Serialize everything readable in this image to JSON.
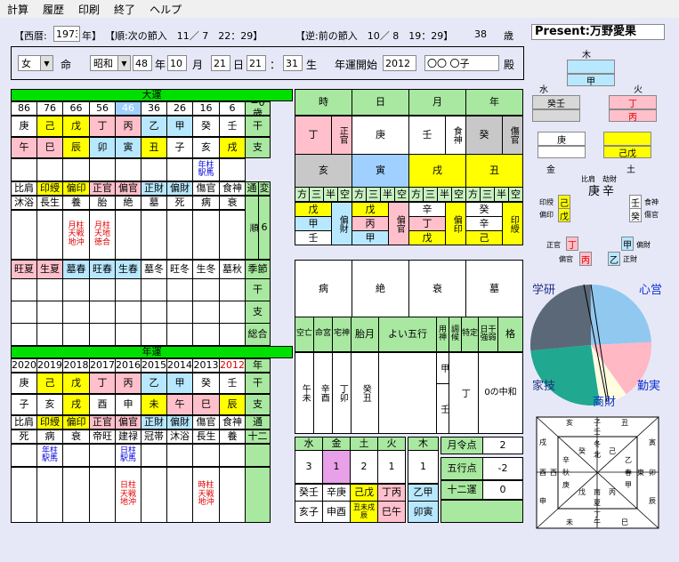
{
  "menu": [
    "計算",
    "履歴",
    "印刷",
    "終了",
    "ヘルプ"
  ],
  "header": {
    "seireki_label": "【西暦:",
    "seireki_value": "1973",
    "nen": "年】",
    "jun": "【順:次の節入　11／ 7　22：29】",
    "gyaku": "【逆:前の節入　10／ 8　19：29】",
    "age": "38",
    "age_unit": "歳",
    "present": "Present:万野愛果"
  },
  "form": {
    "sex": "女",
    "mei": "命",
    "era": "昭和",
    "year": "48",
    "nen": "年",
    "month": "10",
    "tsuki": "月",
    "day": "21",
    "hi": "日",
    "hour": "21",
    "colon": "：",
    "minute": "31",
    "sei": "生",
    "unnen_label": "年運開始",
    "unnen_value": "2012",
    "name": "〇〇 〇子",
    "tono": "殿"
  },
  "daiun": {
    "title": "大運",
    "ages": [
      "86",
      "76",
      "66",
      "56",
      "46",
      "36",
      "26",
      "16",
      "6",
      "−0歳"
    ],
    "stems": [
      "庚",
      "己",
      "戊",
      "丁",
      "丙",
      "乙",
      "甲",
      "癸",
      "壬",
      "干"
    ],
    "branches": [
      "午",
      "巳",
      "辰",
      "卯",
      "寅",
      "丑",
      "子",
      "亥",
      "戌",
      "支"
    ],
    "note_row": [
      "",
      "",
      "",
      "",
      "",
      "",
      "",
      "年柱\n駅馬",
      "",
      ""
    ],
    "stars": [
      "比肩",
      "印綬",
      "偏印",
      "正官",
      "偏官",
      "正財",
      "偏財",
      "傷官",
      "食神",
      "通"
    ],
    "stages": [
      "沐浴",
      "長生",
      "養",
      "胎",
      "絶",
      "墓",
      "死",
      "病",
      "衰",
      "変"
    ],
    "extra": [
      "",
      "",
      "月柱\n天戦\n地沖",
      "月柱\n天地\n徳合",
      "",
      "",
      "",
      "",
      "",
      ""
    ],
    "jun_label": "順",
    "jun_num": "6",
    "seasons": [
      "旺夏",
      "生夏",
      "墓春",
      "旺春",
      "生春",
      "墓冬",
      "旺冬",
      "生冬",
      "墓秋",
      "季節"
    ],
    "side": [
      "干",
      "支",
      "総合"
    ]
  },
  "nenun": {
    "title": "年運",
    "years": [
      "2020",
      "2019",
      "2018",
      "2017",
      "2016",
      "2015",
      "2014",
      "2013",
      "2012",
      "年"
    ],
    "stems": [
      "庚",
      "己",
      "戊",
      "丁",
      "丙",
      "乙",
      "甲",
      "癸",
      "壬",
      "干"
    ],
    "branches": [
      "子",
      "亥",
      "戌",
      "酉",
      "申",
      "未",
      "午",
      "巳",
      "辰",
      "支"
    ],
    "stars": [
      "比肩",
      "印綬",
      "偏印",
      "正官",
      "偏官",
      "正財",
      "偏財",
      "傷官",
      "食神",
      "通"
    ],
    "stages": [
      "死",
      "病",
      "衰",
      "帝旺",
      "建禄",
      "冠帯",
      "沐浴",
      "長生",
      "養",
      "十二"
    ],
    "notes": [
      "",
      "年柱\n駅馬",
      "",
      "",
      "日柱\n駅馬",
      "",
      "",
      "",
      "",
      ""
    ],
    "extra": [
      "",
      "",
      "",
      "",
      "日柱\n天戦\n地沖",
      "",
      "",
      "時柱\n天戦\n地沖",
      "",
      ""
    ]
  },
  "pillars": {
    "headers": [
      "時",
      "日",
      "月",
      "年"
    ],
    "stems": [
      [
        "丁",
        "正官"
      ],
      [
        "庚",
        ""
      ],
      [
        "壬",
        "食神"
      ],
      [
        "癸",
        "傷官"
      ]
    ],
    "branches": [
      "亥",
      "寅",
      "戌",
      "丑"
    ],
    "kuu": [
      "方",
      "三",
      "半",
      "空"
    ],
    "zokan": [
      [
        "戊",
        "甲",
        "壬",
        "偏財"
      ],
      [
        "戊",
        "丙",
        "甲",
        "偏官"
      ],
      [
        "辛",
        "丁",
        "戊",
        "偏印"
      ],
      [
        "癸",
        "辛",
        "己",
        "印綬"
      ]
    ],
    "stages": [
      "病",
      "絶",
      "衰",
      "墓"
    ],
    "bottom_headers": [
      "空亡",
      "命宮",
      "宅神",
      "胎月",
      "よい五行",
      "用神",
      "調候",
      "特定",
      "日干強弱",
      "格"
    ],
    "bottom_vals": [
      "午未",
      "辛酉",
      "丁卯",
      "癸丑",
      "",
      "甲",
      "壬",
      "丁",
      "0の中和",
      ""
    ]
  },
  "gogyo": {
    "headers": [
      "水",
      "金",
      "土",
      "火",
      "木"
    ],
    "counts": [
      "3",
      "1",
      "2",
      "1",
      "1"
    ],
    "pairs": [
      "癸壬",
      "辛庚",
      "己戊",
      "丁丙",
      "乙甲"
    ],
    "pairs2": [
      "亥子",
      "申酉",
      "丑未戌辰",
      "巳午",
      "卯寅"
    ],
    "getsurei_label": "月令点",
    "getsurei": "2",
    "gogyoten_label": "五行点",
    "gogyoten": "-2",
    "juuni_label": "十二運",
    "juuni": "0"
  },
  "chart": {
    "north": "木",
    "west": "水",
    "east": "火",
    "s_left": "金",
    "s_right": "土",
    "mizu1": "癸壬",
    "ki": "甲",
    "hi1": "丁",
    "hi2": "丙",
    "kin": "庚",
    "do": "己戊",
    "hi_label": "比肩",
    "kyozai": "劫財",
    "hi_stem": "庚",
    "kyo_stem": "辛",
    "inju": "印綬",
    "henin": "偏印",
    "inju_s": "己",
    "henin_s": "戊",
    "shokushin": "食神",
    "shokan": "傷官",
    "shoku_s": "壬",
    "shokan_s": "癸",
    "seikan": "正官",
    "henkan": "偏官",
    "seikan_s": "丁",
    "henkan_s": "丙",
    "henzai": "偏財",
    "seizai": "正財",
    "henzai_s": "甲",
    "seizai_s": "乙"
  },
  "pie": {
    "labels": [
      "学研",
      "心営",
      "家技",
      "勤実",
      "商財"
    ],
    "colors": [
      "#5a6878",
      "#90c8f0",
      "#ffb8c4",
      "#fffce0",
      "#20a890"
    ],
    "values": [
      0.22,
      0.2,
      0.23,
      0.1,
      0.25
    ]
  },
  "compass": {
    "top": [
      "亥",
      "子",
      "丑"
    ],
    "left": [
      "戌",
      "酉",
      "申"
    ],
    "right": [
      "寅",
      "卯",
      "辰"
    ],
    "bottom": [
      "未",
      "午",
      "巳"
    ],
    "inner": [
      "北",
      "南",
      "東",
      "西",
      "冬",
      "夏",
      "春",
      "秋"
    ]
  }
}
